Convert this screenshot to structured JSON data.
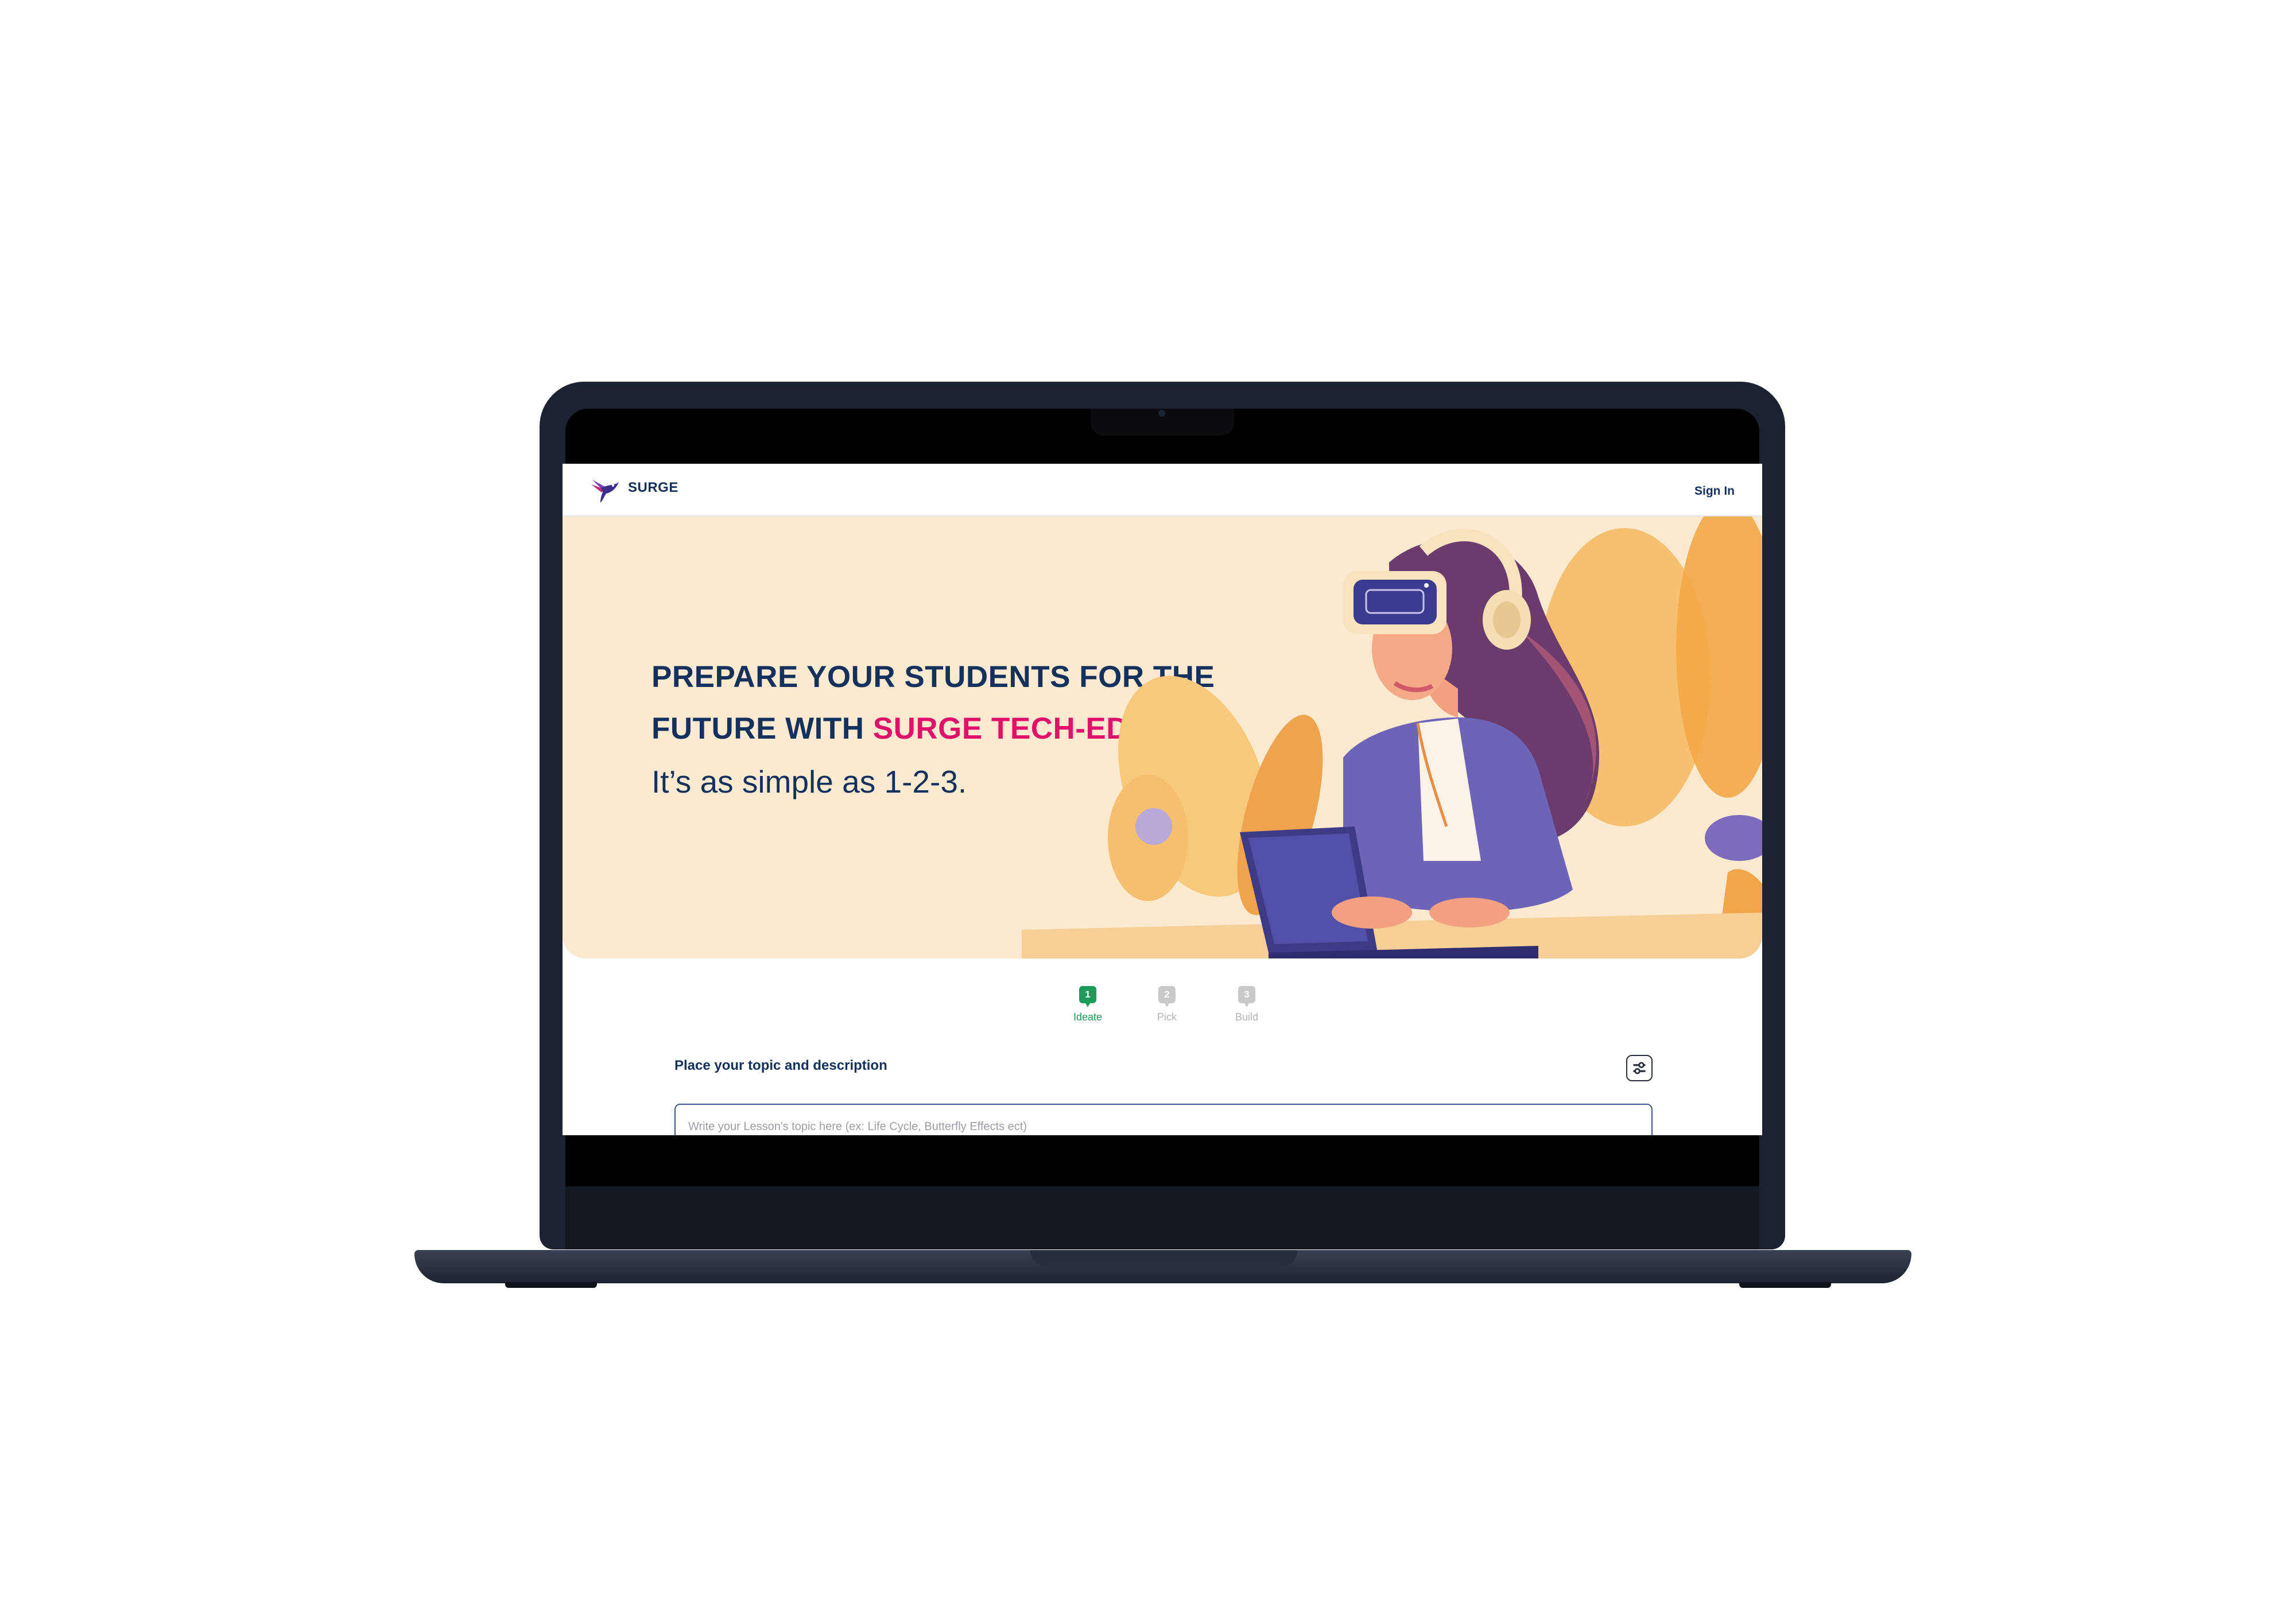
{
  "header": {
    "brand": "SURGE",
    "sign_in": "Sign In"
  },
  "hero": {
    "title_line1": "PREPARE YOUR STUDENTS FOR THE",
    "title_line2_prefix": "FUTURE WITH ",
    "title_line2_accent": "SURGE TECH-ED",
    "subtitle": "It’s as simple as 1-2-3."
  },
  "steps": [
    {
      "number": "1",
      "label": "Ideate",
      "state": "active"
    },
    {
      "number": "2",
      "label": "Pick",
      "state": "inactive"
    },
    {
      "number": "3",
      "label": "Build",
      "state": "inactive"
    }
  ],
  "topic": {
    "label": "Place your topic and description",
    "placeholder": "Write your Lesson's topic here (ex: Life Cycle, Butterfly Effects ect)",
    "value": ""
  },
  "icons": {
    "logo": "hummingbird-icon",
    "filter": "sliders-icon"
  },
  "colors": {
    "brand_navy": "#13315c",
    "accent_pink": "#e0116a",
    "hero_bg": "#fbead0",
    "step_active": "#1e9b5a",
    "step_inactive": "#c9c9cc"
  }
}
